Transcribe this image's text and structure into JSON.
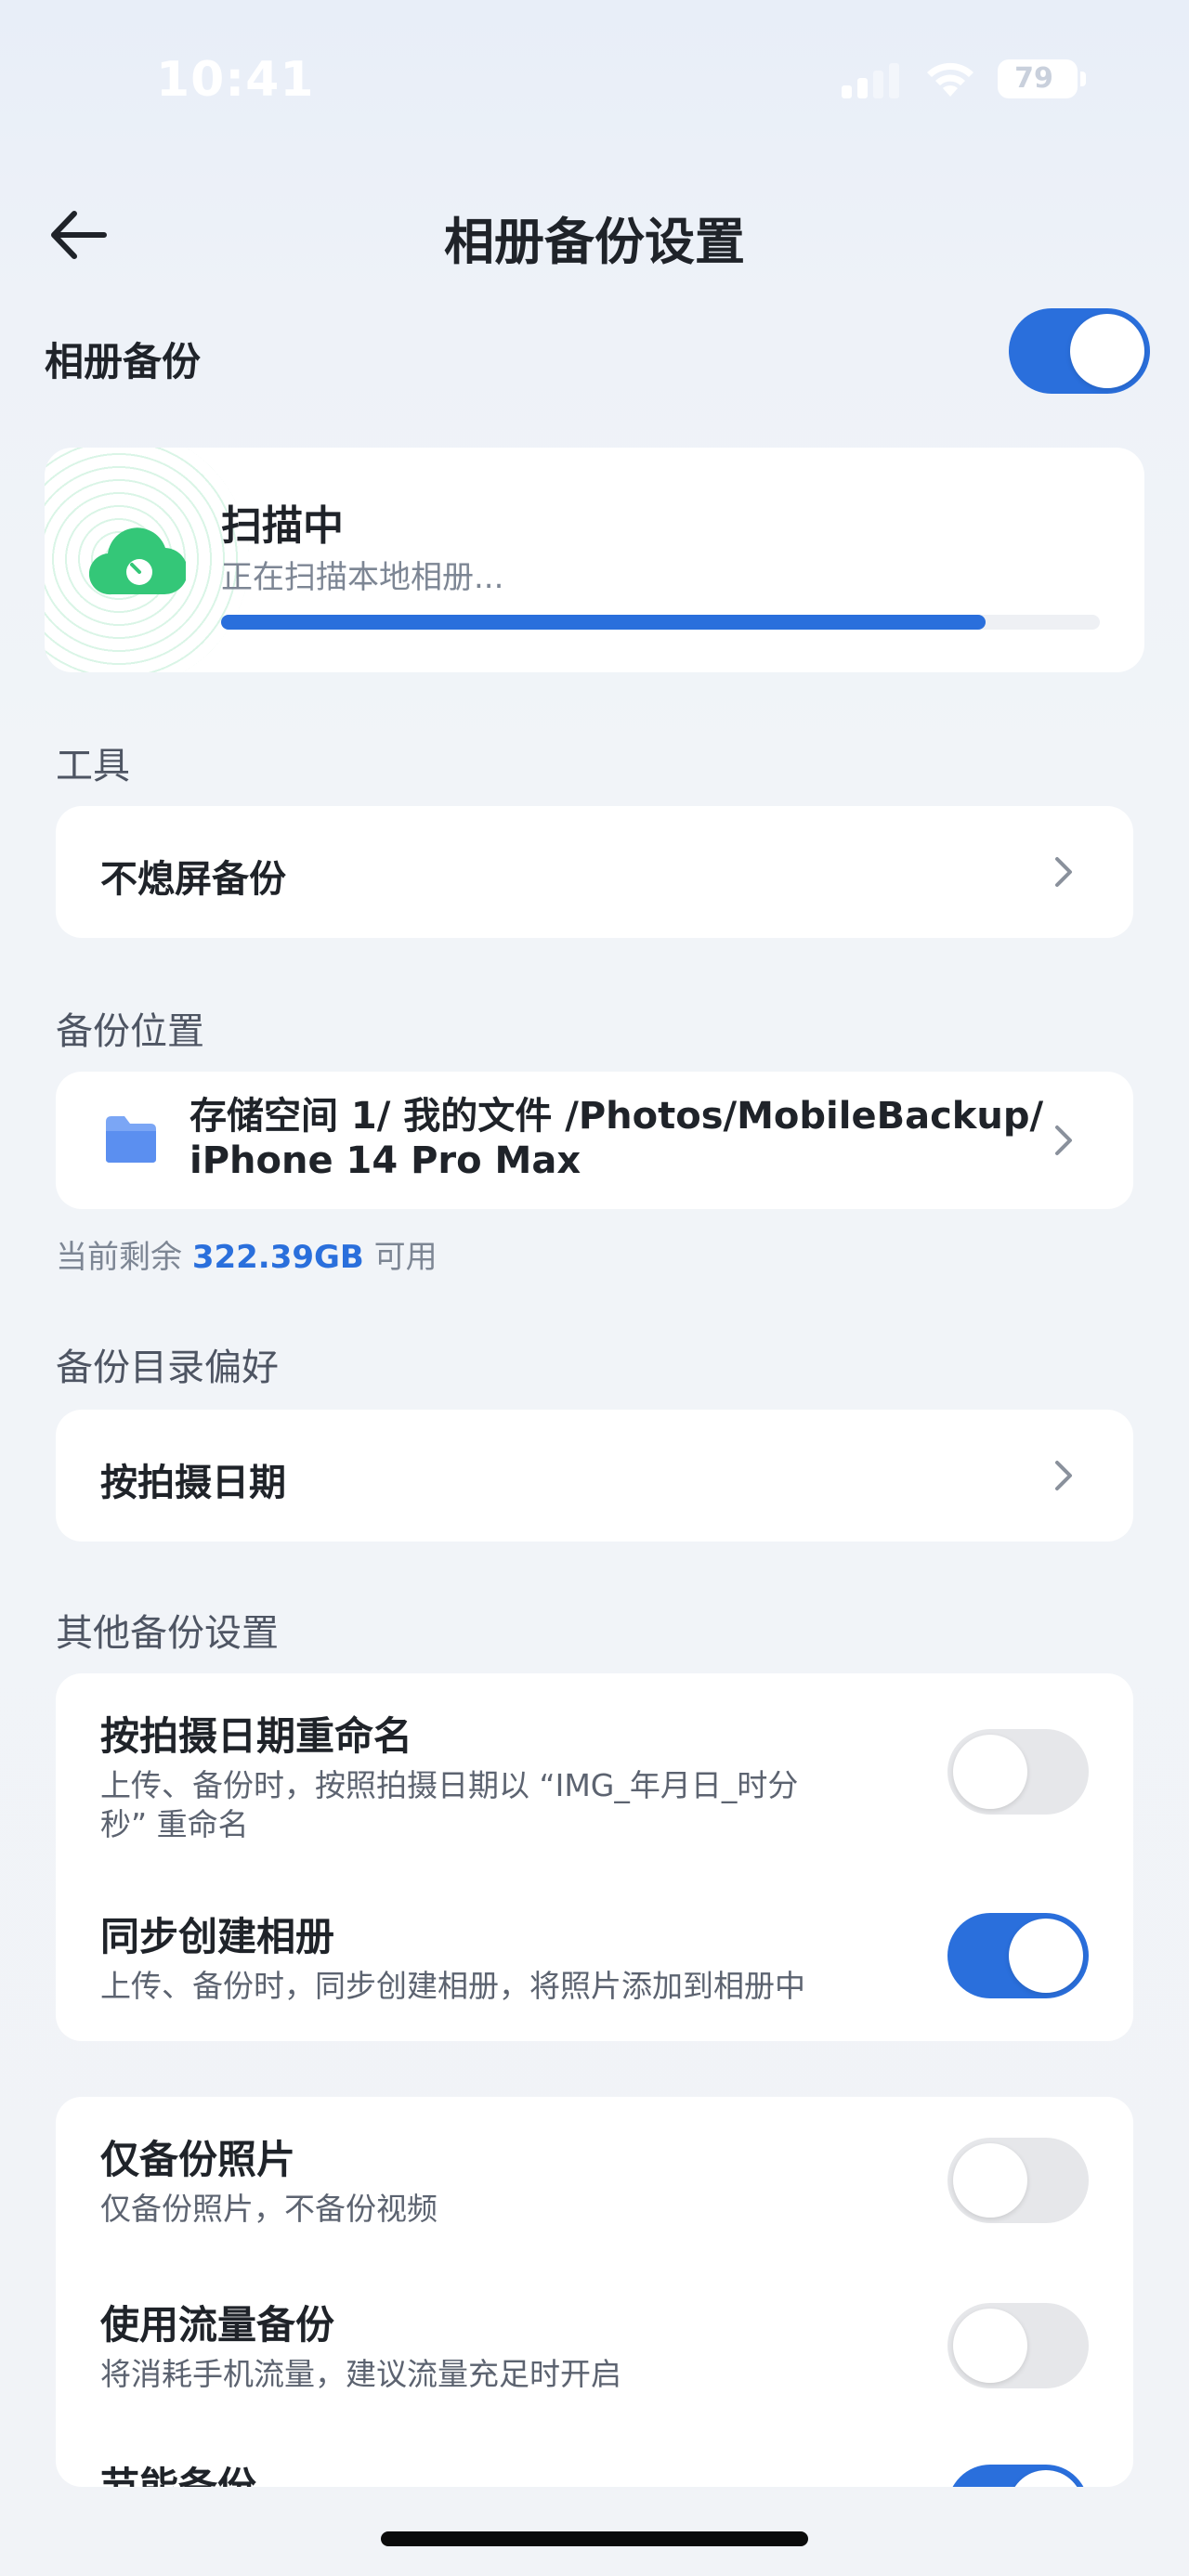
{
  "status_bar": {
    "time": "10:41",
    "battery": "79"
  },
  "nav": {
    "title": "相册备份设置"
  },
  "album_backup": {
    "label": "相册备份",
    "enabled": true
  },
  "scan": {
    "title": "扫描中",
    "subtitle": "正在扫描本地相册...",
    "progress": 0.87
  },
  "tools": {
    "header": "工具",
    "items": [
      {
        "label": "不熄屏备份"
      }
    ]
  },
  "location": {
    "header": "备份位置",
    "path_line1": "存储空间 1/ 我的文件 /Photos/MobileBackup/",
    "path_line2": "iPhone 14 Pro Max",
    "free_prefix": "当前剩余",
    "free_value": "322.39GB",
    "free_suffix": "可用"
  },
  "directory": {
    "header": "备份目录偏好",
    "value": "按拍摄日期"
  },
  "other": {
    "header": "其他备份设置",
    "group1": [
      {
        "title": "按拍摄日期重命名",
        "desc_line1": "上传、备份时，按照拍摄日期以 “IMG_年月日_时分",
        "desc_line2": "秒” 重命名",
        "enabled": false
      },
      {
        "title": "同步创建相册",
        "desc_line1": "上传、备份时，同步创建相册，将照片添加到相册中",
        "enabled": true
      }
    ],
    "group2": [
      {
        "title": "仅备份照片",
        "desc_line1": "仅备份照片，不备份视频",
        "enabled": false
      },
      {
        "title": "使用流量备份",
        "desc_line1": "将消耗手机流量，建议流量充足时开启",
        "enabled": false
      },
      {
        "title": "节能备份",
        "enabled": true
      }
    ]
  },
  "colors": {
    "accent": "#2a6fdc",
    "green": "#34c778"
  },
  "icons": {
    "back": "arrow-left-icon",
    "chevron": "chevron-right-icon",
    "folder": "folder-icon",
    "cloud": "cloud-icon"
  }
}
